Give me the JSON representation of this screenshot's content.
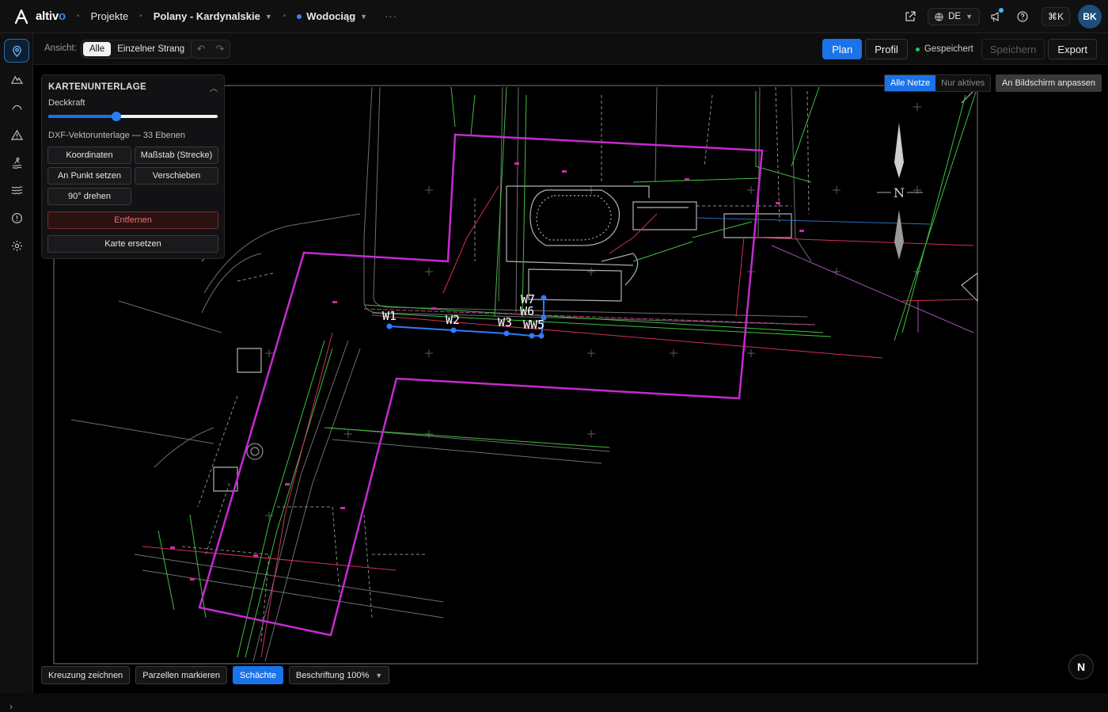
{
  "app": {
    "name_main": "altiv",
    "name_accent": "o"
  },
  "breadcrumb": {
    "projects": "Projekte",
    "project": "Polany - Kardynalskie",
    "network": "Wodociąg",
    "more": "···"
  },
  "header": {
    "language": "DE",
    "shortcut": "⌘K",
    "avatar": "BK",
    "accent": "#1a73e8"
  },
  "toolbar": {
    "view_label": "Ansicht:",
    "view_options": [
      "Alle",
      "Einzelner Strang"
    ],
    "view_selected": "Alle",
    "plan": "Plan",
    "profile": "Profil",
    "status": "Gespeichert",
    "save": "Speichern",
    "export": "Export"
  },
  "map_controls": {
    "net_options": [
      "Alle Netze",
      "Nur aktives"
    ],
    "net_selected": "Alle Netze",
    "fit": "An Bildschirm anpassen"
  },
  "panel": {
    "title": "KARTENUNTERLAGE",
    "opacity_label": "Deckkraft",
    "opacity_value": 0.4,
    "dxf_info": "DXF-Vektorunterlage — 33 Ebenen",
    "buttons": {
      "coordinates": "Koordinaten",
      "scale": "Maßstab (Strecke)",
      "set_point": "An Punkt setzen",
      "move": "Verschieben",
      "rotate": "90° drehen",
      "remove": "Entfernen",
      "replace": "Karte ersetzen"
    }
  },
  "bottom": {
    "draw_crossing": "Kreuzung zeichnen",
    "mark_parcels": "Parzellen markieren",
    "shafts": "Schächte",
    "labels": "Beschriftung 100%"
  },
  "map": {
    "north": "N",
    "badge": "N",
    "nodes": [
      "W1",
      "W2",
      "W3",
      "WW5",
      "W6",
      "W7"
    ]
  },
  "sidebar": {
    "icons": [
      "map-pin-icon",
      "terrain-icon",
      "profile-curve-icon",
      "warning-icon",
      "diver-icon",
      "water-waves-icon",
      "alert-circle-icon",
      "settings-icon"
    ]
  }
}
